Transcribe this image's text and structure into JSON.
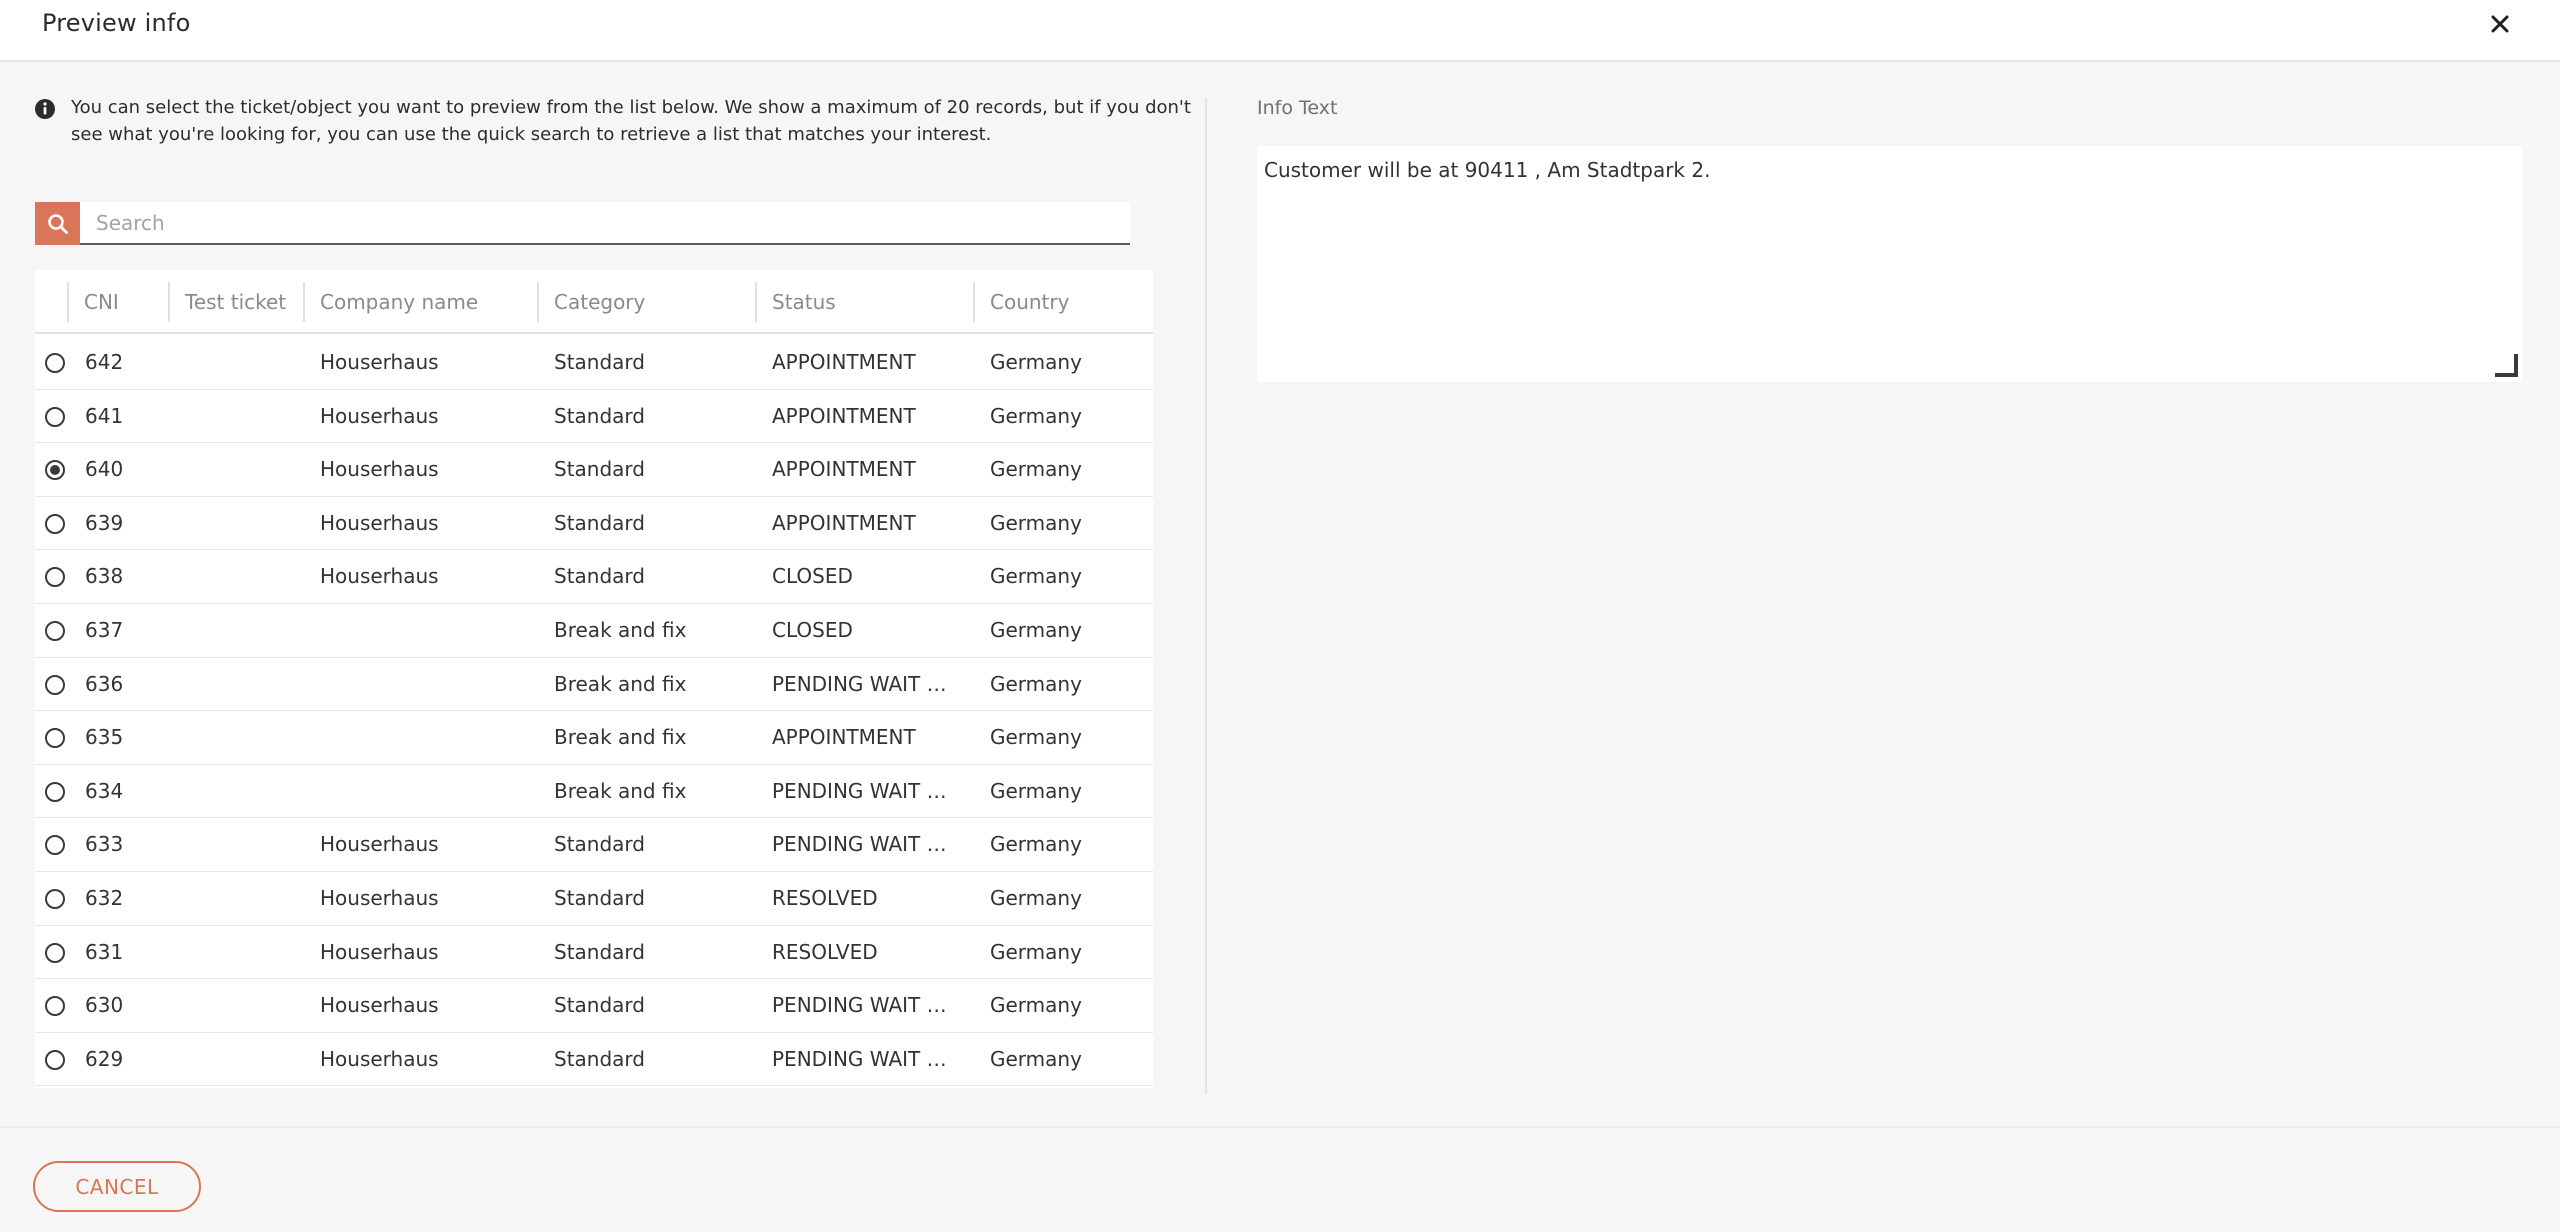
{
  "header": {
    "title": "Preview info"
  },
  "info": {
    "message": "You can select the ticket/object you want to preview from the list below. We show a maximum of 20 records, but if you don't see what you're looking for, you can use the quick search to retrieve a list that matches your interest."
  },
  "search": {
    "placeholder": "Search",
    "value": ""
  },
  "table": {
    "columns": [
      "CNI",
      "Test ticket",
      "Company name",
      "Category",
      "Status",
      "Country"
    ],
    "rows": [
      {
        "selected": false,
        "cni": "642",
        "test_ticket": "",
        "company": "Houserhaus",
        "category": "Standard",
        "status": "APPOINTMENT",
        "country": "Germany"
      },
      {
        "selected": false,
        "cni": "641",
        "test_ticket": "",
        "company": "Houserhaus",
        "category": "Standard",
        "status": "APPOINTMENT",
        "country": "Germany"
      },
      {
        "selected": true,
        "cni": "640",
        "test_ticket": "",
        "company": "Houserhaus",
        "category": "Standard",
        "status": "APPOINTMENT",
        "country": "Germany"
      },
      {
        "selected": false,
        "cni": "639",
        "test_ticket": "",
        "company": "Houserhaus",
        "category": "Standard",
        "status": "APPOINTMENT",
        "country": "Germany"
      },
      {
        "selected": false,
        "cni": "638",
        "test_ticket": "",
        "company": "Houserhaus",
        "category": "Standard",
        "status": "CLOSED",
        "country": "Germany"
      },
      {
        "selected": false,
        "cni": "637",
        "test_ticket": "",
        "company": "",
        "category": "Break and fix",
        "status": "CLOSED",
        "country": "Germany"
      },
      {
        "selected": false,
        "cni": "636",
        "test_ticket": "",
        "company": "",
        "category": "Break and fix",
        "status": "PENDING WAIT ON...",
        "country": "Germany"
      },
      {
        "selected": false,
        "cni": "635",
        "test_ticket": "",
        "company": "",
        "category": "Break and fix",
        "status": "APPOINTMENT",
        "country": "Germany"
      },
      {
        "selected": false,
        "cni": "634",
        "test_ticket": "",
        "company": "",
        "category": "Break and fix",
        "status": "PENDING WAIT ON...",
        "country": "Germany"
      },
      {
        "selected": false,
        "cni": "633",
        "test_ticket": "",
        "company": "Houserhaus",
        "category": "Standard",
        "status": "PENDING WAIT ON...",
        "country": "Germany"
      },
      {
        "selected": false,
        "cni": "632",
        "test_ticket": "",
        "company": "Houserhaus",
        "category": "Standard",
        "status": "RESOLVED",
        "country": "Germany"
      },
      {
        "selected": false,
        "cni": "631",
        "test_ticket": "",
        "company": "Houserhaus",
        "category": "Standard",
        "status": "RESOLVED",
        "country": "Germany"
      },
      {
        "selected": false,
        "cni": "630",
        "test_ticket": "",
        "company": "Houserhaus",
        "category": "Standard",
        "status": "PENDING WAIT ON...",
        "country": "Germany"
      },
      {
        "selected": false,
        "cni": "629",
        "test_ticket": "",
        "company": "Houserhaus",
        "category": "Standard",
        "status": "PENDING WAIT ON...",
        "country": "Germany"
      }
    ]
  },
  "info_panel": {
    "label": "Info Text",
    "value": "Customer will be at 90411 , Am Stadtpark 2."
  },
  "footer": {
    "cancel_label": "CANCEL"
  },
  "colors": {
    "accent": "#d97559",
    "text": "#333333",
    "muted": "#8a8a8a",
    "background": "#f6f6f6"
  },
  "icons": {
    "close": "close-icon",
    "info": "info-icon",
    "search": "search-icon",
    "resize": "resize-handle-icon"
  }
}
